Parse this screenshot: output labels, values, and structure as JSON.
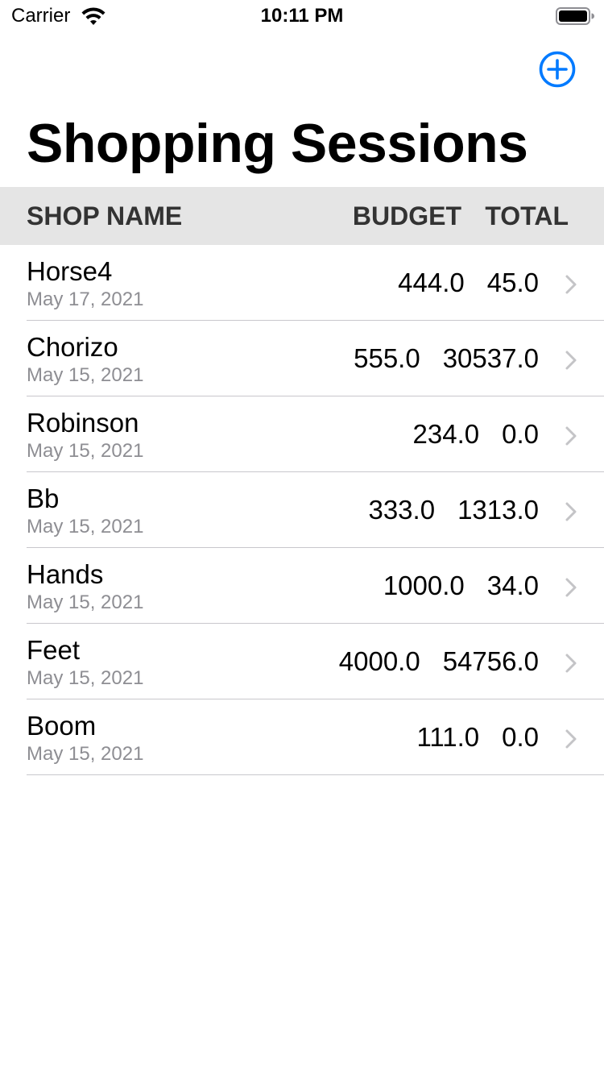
{
  "status_bar": {
    "carrier": "Carrier",
    "time": "10:11 PM",
    "icons": [
      "wifi-icon",
      "battery-icon"
    ]
  },
  "nav": {
    "title": "Shopping Sessions",
    "add_icon": "plus-circle-icon",
    "accent_color": "#007aff"
  },
  "table": {
    "columns": {
      "shop_name": "SHOP NAME",
      "budget": "BUDGET",
      "total": "TOTAL"
    },
    "header_background": "#e5e5e5",
    "rows": [
      {
        "name": "Horse4",
        "date": "May 17, 2021",
        "budget": "444.0",
        "total": "45.0"
      },
      {
        "name": "Chorizo",
        "date": "May 15, 2021",
        "budget": "555.0",
        "total": "30537.0"
      },
      {
        "name": "Robinson",
        "date": "May 15, 2021",
        "budget": "234.0",
        "total": "0.0"
      },
      {
        "name": "Bb",
        "date": "May 15, 2021",
        "budget": "333.0",
        "total": "1313.0"
      },
      {
        "name": "Hands",
        "date": "May 15, 2021",
        "budget": "1000.0",
        "total": "34.0"
      },
      {
        "name": "Feet",
        "date": "May 15, 2021",
        "budget": "4000.0",
        "total": "54756.0"
      },
      {
        "name": "Boom",
        "date": "May 15, 2021",
        "budget": "111.0",
        "total": "0.0"
      }
    ]
  }
}
